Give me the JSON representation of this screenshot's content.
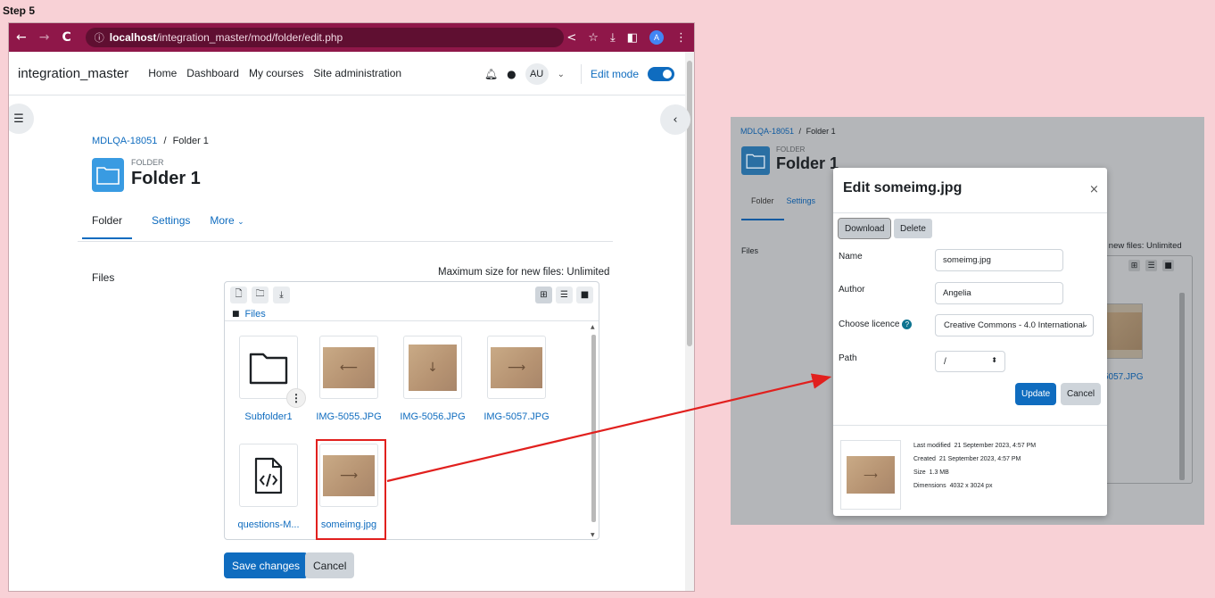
{
  "step_label": "Step 5",
  "browser": {
    "url_host": "localhost",
    "url_path": "/integration_master/mod/folder/edit.php"
  },
  "navbar": {
    "brand": "integration_master",
    "links": [
      "Home",
      "Dashboard",
      "My courses",
      "Site administration"
    ],
    "avatar_initials": "AU",
    "edit_mode_label": "Edit mode"
  },
  "page": {
    "breadcrumb": {
      "course": "MDLQA-18051",
      "separator": "/",
      "current": "Folder 1"
    },
    "activity_type": "FOLDER",
    "title": "Folder 1",
    "tabs": {
      "folder": "Folder",
      "settings": "Settings",
      "more": "More"
    },
    "files_label": "Files",
    "max_size": "Maximum size for new files: Unlimited",
    "path_label": "Files",
    "files": {
      "subfolder": "Subfolder1",
      "img1": "IMG-5055.JPG",
      "img2": "IMG-5056.JPG",
      "img3": "IMG-5057.JPG",
      "questions": "questions-M...",
      "someimg": "someimg.jpg"
    },
    "save_label": "Save changes",
    "cancel_label": "Cancel"
  },
  "right_panel": {
    "breadcrumb": {
      "course": "MDLQA-18051",
      "separator": "/",
      "current": "Folder 1"
    },
    "activity_type": "FOLDER",
    "title": "Folder 1",
    "tabs": {
      "folder": "Folder",
      "settings": "Settings"
    },
    "files_label": "Files",
    "max_size_partial": "r new files: Unlimited",
    "partial_label": "5057.JPG"
  },
  "modal": {
    "title": "Edit someimg.jpg",
    "close_glyph": "×",
    "download_label": "Download",
    "delete_label": "Delete",
    "name_label": "Name",
    "name_value": "someimg.jpg",
    "author_label": "Author",
    "author_value": "Angelia",
    "licence_label": "Choose licence",
    "licence_value": "Creative Commons - 4.0 International",
    "path_label": "Path",
    "path_value": "/",
    "update_label": "Update",
    "cancel_label": "Cancel",
    "meta": {
      "last_modified_k": "Last modified",
      "last_modified_v": "21 September 2023, 4:57 PM",
      "created_k": "Created",
      "created_v": "21 September 2023, 4:57 PM",
      "size_k": "Size",
      "size_v": "1.3 MB",
      "dimensions_k": "Dimensions",
      "dimensions_v": "4032 x 3024 px"
    }
  },
  "colors": {
    "chrome_bar": "#8f1749",
    "primary": "#0f6cbf",
    "highlight": "#e1201e",
    "background": "#f8d1d6"
  }
}
